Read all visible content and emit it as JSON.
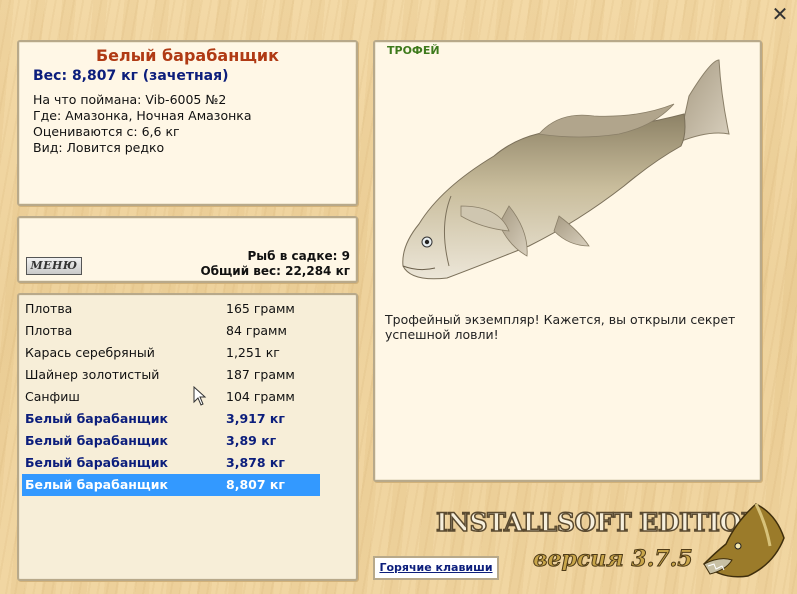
{
  "window": {
    "close_label": "✕"
  },
  "info": {
    "fish_name": "Белый барабанщик",
    "weight_line": "Вес: 8,807 кг (зачетная)",
    "bait_line": "На что поймана: Vib-6005 №2",
    "location_line": "Где: Амазонка, Ночная Амазонка",
    "rated_line": "Оцениваются с: 6,6 кг",
    "kind_line": "Вид: Ловится редко"
  },
  "stats": {
    "menu_label": "МЕНЮ",
    "count_line": "Рыб в садке: 9",
    "total_line": "Общий вес: 22,284 кг"
  },
  "catch": {
    "rows": [
      {
        "name": "Плотва",
        "weight": "165 грамм"
      },
      {
        "name": "Плотва",
        "weight": "84 грамм"
      },
      {
        "name": "Карась серебряный",
        "weight": "1,251 кг"
      },
      {
        "name": "Шайнер золотистый",
        "weight": "187 грамм"
      },
      {
        "name": "Санфиш",
        "weight": "104 грамм"
      },
      {
        "name": "Белый барабанщик",
        "weight": "3,917 кг"
      },
      {
        "name": "Белый барабанщик",
        "weight": "3,89 кг"
      },
      {
        "name": "Белый барабанщик",
        "weight": "3,878 кг"
      },
      {
        "name": "Белый барабанщик",
        "weight": "8,807 кг"
      }
    ],
    "selected_index": 8
  },
  "trophy": {
    "badge": "ТРОФЕЙ",
    "description": "Трофейный экземпляр! Кажется, вы открыли секрет успешной ловли!"
  },
  "footer": {
    "hotkeys_label": "Горячие клавиши",
    "brand": "INSTALLSOFT EDITION",
    "version": "версия 3.7.5"
  },
  "colors": {
    "title_red": "#b03a14",
    "trophy_blue": "#0c1e7c",
    "selection": "#3399ff",
    "badge_green": "#3e7a1c"
  },
  "icons": [
    "close-icon",
    "fish-image",
    "pike-logo-icon",
    "mouse-cursor-icon"
  ]
}
